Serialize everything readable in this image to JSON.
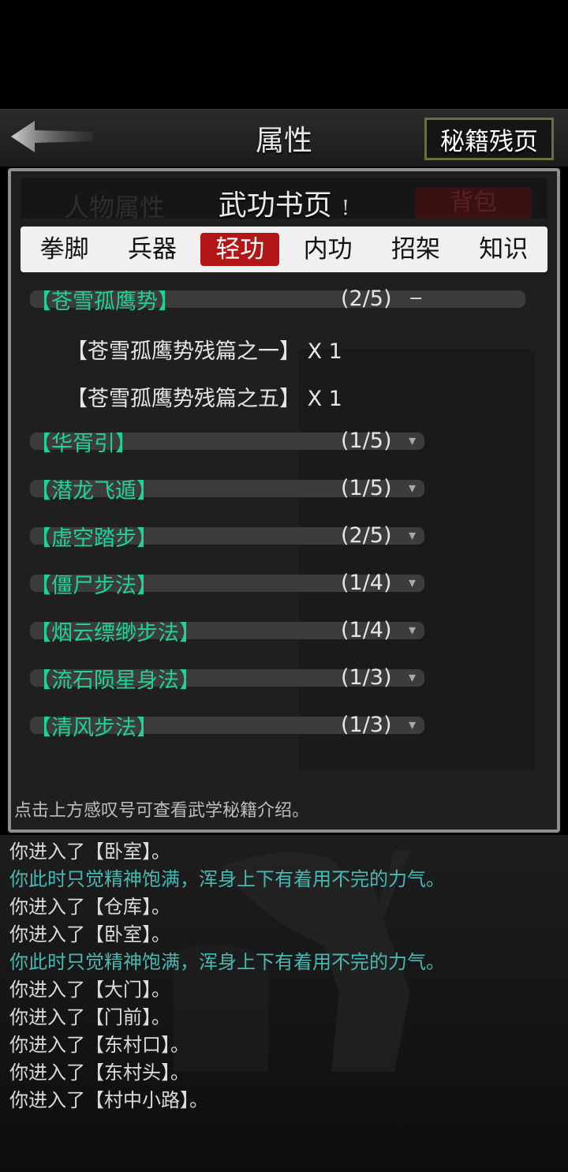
{
  "header": {
    "title": "属性",
    "secret_button": "秘籍残页"
  },
  "panel": {
    "ghost_left": "人物属性",
    "ghost_right": "背包",
    "title": "武功书页",
    "info_mark": "!",
    "tabs": [
      "拳脚",
      "兵器",
      "轻功",
      "内功",
      "招架",
      "知识"
    ],
    "active_tab": "轻功",
    "skills": [
      {
        "name": "【苍雪孤鹰势】",
        "count": "(2/5)",
        "expanded": true,
        "fragments": [
          {
            "name": "【苍雪孤鹰势残篇之一】",
            "qty": "X 1"
          },
          {
            "name": "【苍雪孤鹰势残篇之五】",
            "qty": "X 1"
          }
        ]
      },
      {
        "name": "【华胥引】",
        "count": "(1/5)"
      },
      {
        "name": "【潜龙飞遁】",
        "count": "(1/5)"
      },
      {
        "name": "【虚空踏步】",
        "count": "(2/5)"
      },
      {
        "name": "【僵尸步法】",
        "count": "(1/4)"
      },
      {
        "name": "【烟云缥缈步法】",
        "count": "(1/4)"
      },
      {
        "name": "【流石陨星身法】",
        "count": "(1/3)"
      },
      {
        "name": "【清风步法】",
        "count": "(1/3)"
      }
    ],
    "hint": "点击上方感叹号可查看武学秘籍介绍。"
  },
  "log": [
    {
      "text": "你进入了【卧室】。",
      "color": "#dcdcdc"
    },
    {
      "text": "你此时只觉精神饱满，浑身上下有着用不完的力气。",
      "color": "#47b9b4"
    },
    {
      "text": "你进入了【仓库】。",
      "color": "#dcdcdc"
    },
    {
      "text": "你进入了【卧室】。",
      "color": "#dcdcdc"
    },
    {
      "text": "你此时只觉精神饱满，浑身上下有着用不完的力气。",
      "color": "#47b9b4"
    },
    {
      "text": "你进入了【大门】。",
      "color": "#dcdcdc"
    },
    {
      "text": "你进入了【门前】。",
      "color": "#dcdcdc"
    },
    {
      "text": "你进入了【东村口】。",
      "color": "#dcdcdc"
    },
    {
      "text": "你进入了【东村头】。",
      "color": "#dcdcdc"
    },
    {
      "text": "你进入了【村中小路】。",
      "color": "#dcdcdc"
    }
  ]
}
